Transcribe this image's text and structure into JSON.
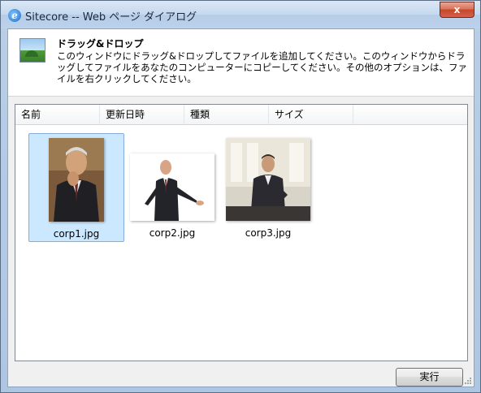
{
  "window": {
    "title": "Sitecore -- Web ページ ダイアログ",
    "close_label": "x",
    "browser_icon": "ie-icon"
  },
  "header": {
    "icon": "image-icon",
    "title": "ドラッグ&ドロップ",
    "description": "このウィンドウにドラッグ&ドロップしてファイルを追加してください。このウィンドウからドラッグしてファイルをあなたのコンピューターにコピーしてください。その他のオプションは、ファイルを右クリックしてください。"
  },
  "columns": [
    "名前",
    "更新日時",
    "種類",
    "サイズ"
  ],
  "files": [
    {
      "name": "corp1.jpg",
      "selected": true
    },
    {
      "name": "corp2.jpg",
      "selected": false
    },
    {
      "name": "corp3.jpg",
      "selected": false
    }
  ],
  "footer": {
    "run_label": "実行"
  },
  "colors": {
    "selection": "#cce8ff",
    "selection_border": "#84acdd",
    "close_button": "#c7472a"
  }
}
